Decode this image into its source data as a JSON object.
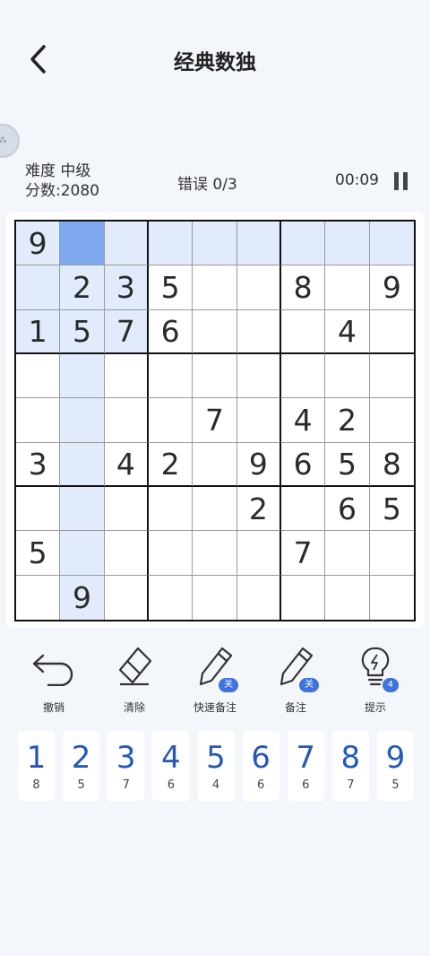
{
  "header": {
    "title": "经典数独"
  },
  "status": {
    "difficulty": "难度 中级",
    "score": "分数:2080",
    "errors": "错误 0/3",
    "timer": "00:09"
  },
  "board": [
    [
      "9",
      "",
      "",
      "",
      "",
      "",
      "",
      "",
      ""
    ],
    [
      "",
      "2",
      "3",
      "5",
      "",
      "",
      "8",
      "",
      "9"
    ],
    [
      "1",
      "5",
      "7",
      "6",
      "",
      "",
      "",
      "4",
      ""
    ],
    [
      "",
      "",
      "",
      "",
      "",
      "",
      "",
      "",
      ""
    ],
    [
      "",
      "",
      "",
      "",
      "7",
      "",
      "4",
      "2",
      ""
    ],
    [
      "3",
      "",
      "4",
      "2",
      "",
      "9",
      "6",
      "5",
      "8"
    ],
    [
      "",
      "",
      "",
      "",
      "",
      "2",
      "",
      "6",
      "5"
    ],
    [
      "5",
      "",
      "",
      "",
      "",
      "",
      "7",
      "",
      ""
    ],
    [
      "",
      "9",
      "",
      "",
      "",
      "",
      "",
      "",
      ""
    ]
  ],
  "selected_cell": [
    0,
    1
  ],
  "tools": [
    {
      "label": "撤销",
      "icon": "undo-icon"
    },
    {
      "label": "清除",
      "icon": "eraser-icon"
    },
    {
      "label": "快速备注",
      "icon": "pencil-icon",
      "badge": "关"
    },
    {
      "label": "备注",
      "icon": "pencil-icon",
      "badge": "关"
    },
    {
      "label": "提示",
      "icon": "lightbulb-icon",
      "badge": "4"
    }
  ],
  "numpad": [
    {
      "digit": "1",
      "remaining": "8"
    },
    {
      "digit": "2",
      "remaining": "5"
    },
    {
      "digit": "3",
      "remaining": "7"
    },
    {
      "digit": "4",
      "remaining": "6"
    },
    {
      "digit": "5",
      "remaining": "4"
    },
    {
      "digit": "6",
      "remaining": "6"
    },
    {
      "digit": "7",
      "remaining": "6"
    },
    {
      "digit": "8",
      "remaining": "7"
    },
    {
      "digit": "9",
      "remaining": "5"
    }
  ],
  "colors": {
    "selected": "#7ea9f1",
    "highlight": "#e2ebfb",
    "digit_blue": "#2458b8",
    "badge_blue": "#3f72dc"
  }
}
